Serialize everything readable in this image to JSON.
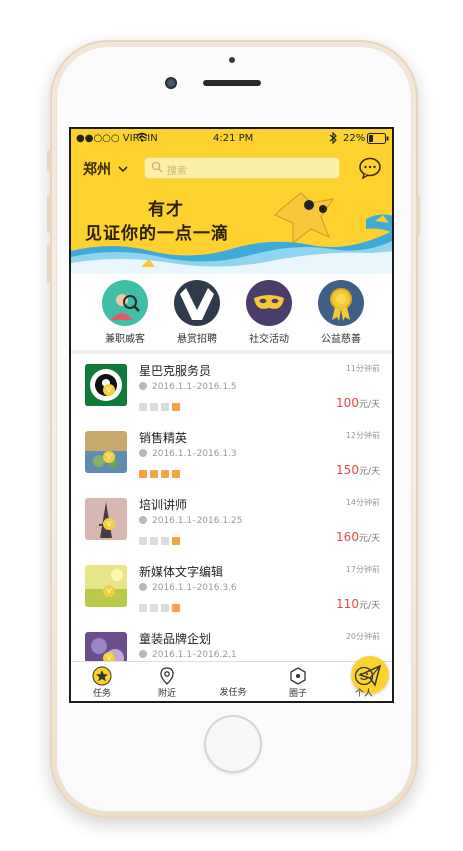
{
  "status_bar": {
    "carrier": "●●○○○ VIRGIN",
    "time": "4:21 PM",
    "battery": "22%"
  },
  "header": {
    "city": "郑州",
    "search_placeholder": "搜索"
  },
  "banner": {
    "line1": "有才",
    "line2": "见证你的一点一滴"
  },
  "categories": [
    {
      "label": "兼职威客",
      "icon": "person-search-icon",
      "color": "#3ebfa6"
    },
    {
      "label": "悬赏招聘",
      "icon": "suit-icon",
      "color": "#2f3b4a"
    },
    {
      "label": "社交活动",
      "icon": "mask-icon",
      "color": "#4a3c6b"
    },
    {
      "label": "公益慈善",
      "icon": "medal-icon",
      "color": "#3e5f86"
    }
  ],
  "jobs": [
    {
      "title": "星巴克服务员",
      "date": "2016.1.1–2016.1.5",
      "time": "11分钟前",
      "price": "100",
      "unit": "元/天",
      "thumb": "starbucks-logo"
    },
    {
      "title": "销售精英",
      "date": "2016.1.1–2016.1.3",
      "time": "12分钟前",
      "price": "150",
      "unit": "元/天",
      "thumb": "landscape-photo"
    },
    {
      "title": "培训讲师",
      "date": "2016.1.1–2016.1.25",
      "time": "14分钟前",
      "price": "160",
      "unit": "元/天",
      "thumb": "eiffel-photo"
    },
    {
      "title": "新媒体文字编辑",
      "date": "2016.1.1–2016.3.6",
      "time": "17分钟前",
      "price": "110",
      "unit": "元/天",
      "thumb": "field-photo"
    },
    {
      "title": "童装品牌企划",
      "date": "2016.1.1–2016.2.1",
      "time": "20分钟前",
      "price": "",
      "unit": "",
      "thumb": "purple-photo"
    }
  ],
  "tabbar": [
    {
      "label": "任务",
      "icon": "star-icon"
    },
    {
      "label": "附近",
      "icon": "location-pin-icon"
    },
    {
      "label": "发任务",
      "icon": "paper-plane-icon"
    },
    {
      "label": "圈子",
      "icon": "circle-group-icon"
    },
    {
      "label": "个人",
      "icon": "smiley-icon"
    }
  ]
}
